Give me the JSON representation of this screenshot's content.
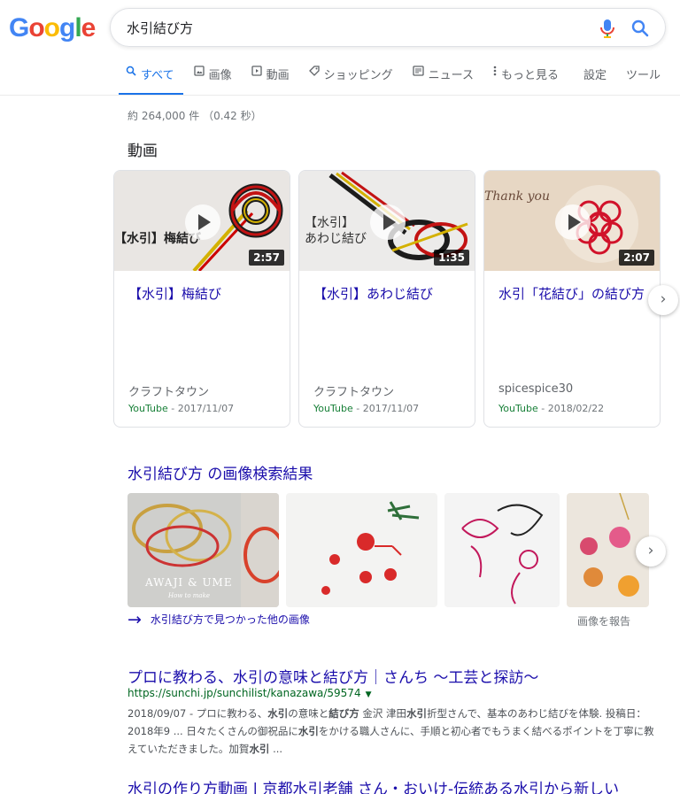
{
  "header": {
    "logo_letters": [
      {
        "ch": "G",
        "color": "#4285f4"
      },
      {
        "ch": "o",
        "color": "#ea4335"
      },
      {
        "ch": "o",
        "color": "#fbbc05"
      },
      {
        "ch": "g",
        "color": "#4285f4"
      },
      {
        "ch": "l",
        "color": "#34a853"
      },
      {
        "ch": "e",
        "color": "#ea4335"
      }
    ],
    "search_query": "水引結び方"
  },
  "tabs": [
    {
      "label": "すべて",
      "icon": "search-icon",
      "active": true
    },
    {
      "label": "画像",
      "icon": "image-icon",
      "active": false
    },
    {
      "label": "動画",
      "icon": "video-icon",
      "active": false
    },
    {
      "label": "ショッピング",
      "icon": "tag-icon",
      "active": false
    },
    {
      "label": "ニュース",
      "icon": "news-icon",
      "active": false
    },
    {
      "label": "もっと見る",
      "icon": "more-vert-icon",
      "active": false
    },
    {
      "label": "設定",
      "icon": "",
      "active": false
    },
    {
      "label": "ツール",
      "icon": "",
      "active": false
    }
  ],
  "result_stats": "約 264,000 件 （0.42 秒）",
  "videos_section": {
    "title": "動画",
    "cards": [
      {
        "thumb_text": "【水引】梅結び",
        "duration": "2:57",
        "title": "【水引】梅結び",
        "channel": "クラフトタウン",
        "source": "YouTube",
        "date": " - 2017/11/07"
      },
      {
        "thumb_text": "【水引】\nあわじ結び",
        "duration": "1:35",
        "title": "【水引】あわじ結び",
        "channel": "クラフトタウン",
        "source": "YouTube",
        "date": " - 2017/11/07"
      },
      {
        "thumb_text": "Thank you",
        "duration": "2:07",
        "title": "水引「花結び」の結び方",
        "channel": "spicespice30",
        "source": "YouTube",
        "date": " - 2018/02/22"
      }
    ]
  },
  "images_section": {
    "title": "水引結び方 の画像検索結果",
    "tile1_caption": "AWAJI & UME",
    "tile1_subcaption": "How to make",
    "more_link": "水引結び方で見つかった他の画像",
    "report": "画像を報告"
  },
  "results": [
    {
      "title": "プロに教わる、水引の意味と結び方｜さんち 〜工芸と探訪〜",
      "url": "https://sunchi.jp/sunchilist/kanazawa/59574",
      "snippet_parts": [
        {
          "t": "2018/09/07 - プロに教わる、",
          "b": false
        },
        {
          "t": "水引",
          "b": true
        },
        {
          "t": "の意味と",
          "b": false
        },
        {
          "t": "結び方",
          "b": true
        },
        {
          "t": " 金沢 津田",
          "b": false
        },
        {
          "t": "水引",
          "b": true
        },
        {
          "t": "折型さんで、基本のあわじ結びを体験. 投稿日： 2018年9 ... 日々たくさんの御祝品に",
          "b": false
        },
        {
          "t": "水引",
          "b": true
        },
        {
          "t": "をかける職人さんに、手順と初心者でもうまく結べるポイントを丁寧に教えていただきました。加賀",
          "b": false
        },
        {
          "t": "水引",
          "b": true
        },
        {
          "t": " ...",
          "b": false
        }
      ]
    },
    {
      "title": "水引の作り方動画 | 京都水引老舗 さん・おいけ-伝統ある水引から新しい"
    }
  ],
  "colors": {
    "link": "#1a0dab",
    "accent": "#1a73e8",
    "url_green": "#006621",
    "youtube_green": "#188038"
  }
}
